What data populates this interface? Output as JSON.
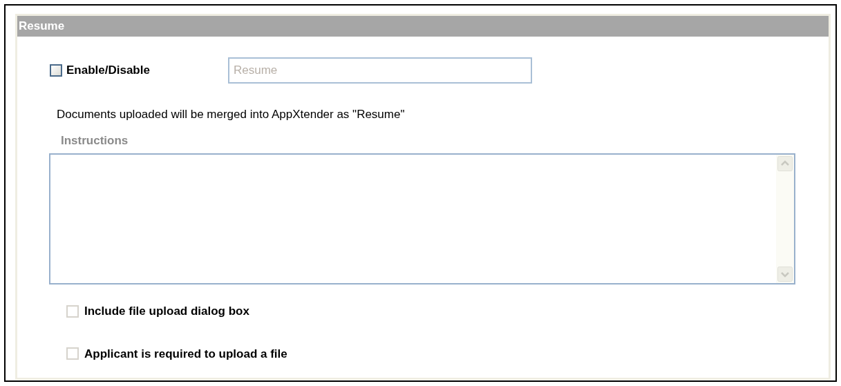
{
  "panel": {
    "title": "Resume"
  },
  "enable": {
    "label": "Enable/Disable",
    "checked": false
  },
  "name_field": {
    "placeholder": "Resume"
  },
  "note": "Documents uploaded will be merged into AppXtender as \"Resume\"",
  "instructions": {
    "label": "Instructions"
  },
  "options": [
    {
      "label": "Include file upload dialog box",
      "checked": false,
      "disabled": true
    },
    {
      "label": "Applicant is required to upload a file",
      "checked": false,
      "disabled": true
    }
  ]
}
